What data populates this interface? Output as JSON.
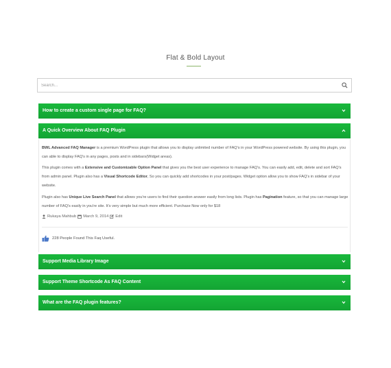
{
  "page": {
    "title": "Flat & Bold Layout"
  },
  "search": {
    "placeholder": "Search..."
  },
  "faqs": [
    {
      "question": "How to create a custom single page for FAQ?"
    },
    {
      "question": "A Quick Overview About FAQ Plugin"
    },
    {
      "question": "Support Media Library Image"
    },
    {
      "question": "Support Theme Shortcode As FAQ Content"
    },
    {
      "question": "What are the FAQ plugin features?"
    }
  ],
  "answer": {
    "p1_bold": "BWL Advanced FAQ Manager",
    "p1_text": " is a premium WordPress plugin that allows you to display unlimited number of FAQ's in your WordPress powered website. By using this plugin, you can able to display FAQ's in any pages, posts and in sidebars(Widget areas).",
    "p2_a": "This plugin comes with a ",
    "p2_bold1": "Extensive and Customizable Option Panel",
    "p2_b": " that gives you the best user experience to manage FAQ's. You can easily add, edit, delete and sort FAQ's from admin panel. Plugin also has a ",
    "p2_bold2": "Visual Shortcode Editor",
    "p2_c": ", So you can quickly add shortcodes in your post/pages. Widget option allow you to show FAQ's in sidebar of your website.",
    "p3_a": "Plugin also has ",
    "p3_bold1": "Unique Live Search Panel",
    "p3_b": " that allows you're users to find their question answer easily from long lists. Plugin has ",
    "p3_bold2": "Pagination",
    "p3_c": " feature, so that you can manage large number of FAQ's easily in you're site. It's very simple but much more efficient. Purchase Now only for $18",
    "author": "Rukaya Mahbub",
    "date": "March 9, 2014",
    "edit": "Edit",
    "useful": "228 People Found This Faq Useful."
  },
  "colors": {
    "accent": "#16ad37",
    "underline": "#8ab56a",
    "thumb": "#4a78c8"
  },
  "icons": {
    "search": "search-icon",
    "chevron_down": "chevron-down-icon",
    "chevron_up": "chevron-up-icon",
    "user": "user-icon",
    "calendar": "calendar-icon",
    "edit": "edit-icon",
    "thumb": "thumbs-up-icon"
  }
}
